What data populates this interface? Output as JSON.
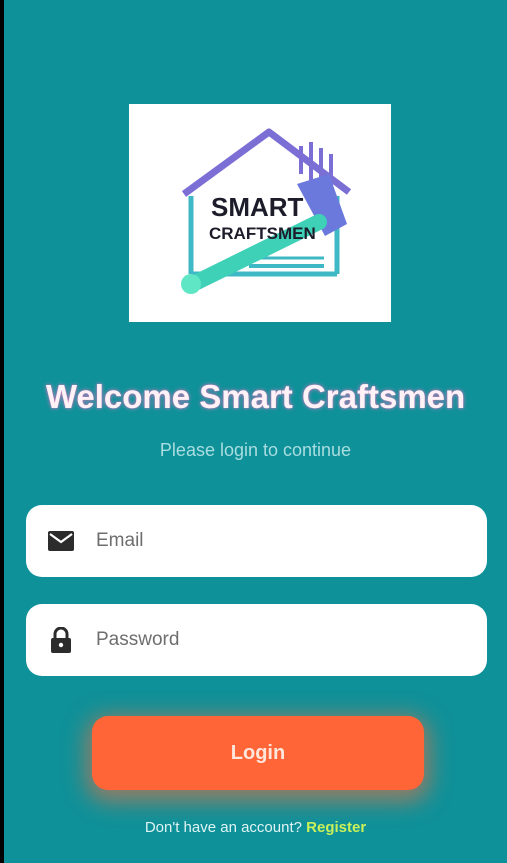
{
  "app": {
    "logo": {
      "text_line1": "SMART",
      "text_line2": "CRAFTSMEN",
      "icon": "house-hammer-logo"
    },
    "welcome_title": "Welcome Smart Craftsmen",
    "subtitle": "Please login to continue",
    "email_field": {
      "placeholder": "Email",
      "value": "",
      "icon": "mail-icon"
    },
    "password_field": {
      "placeholder": "Password",
      "value": "",
      "icon": "lock-icon"
    },
    "login_label": "Login",
    "footer_text": "Don't have an account?",
    "register_label": "Register",
    "colors": {
      "background": "#0f9199",
      "button": "#ff6536",
      "register_link": "#c8f15a"
    }
  }
}
